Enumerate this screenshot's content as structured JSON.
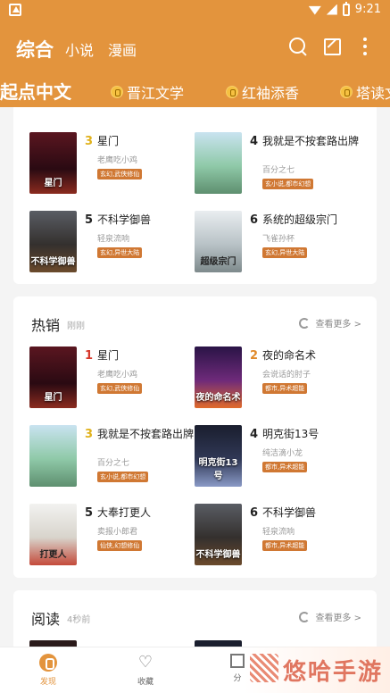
{
  "status": {
    "time": "9:21"
  },
  "appbar": {
    "tabs": [
      "综合",
      "小说",
      "漫画"
    ]
  },
  "channels": [
    {
      "label": "起点中文"
    },
    {
      "label": "晋江文学"
    },
    {
      "label": "红袖添香"
    },
    {
      "label": "塔读文"
    }
  ],
  "section1": {
    "books": [
      {
        "rank": "3",
        "title": "星门",
        "author": "老鹰吃小鸡",
        "tag": "玄幻,武侠修仙",
        "cover_text": "星门",
        "rank_color": "#e0b11b"
      },
      {
        "rank": "4",
        "title": "我就是不按套路出牌",
        "author": "百分之七",
        "tag": "玄小说,都市幻想",
        "cover_text": "",
        "rank_color": "#222"
      },
      {
        "rank": "5",
        "title": "不科学御兽",
        "author": "轻泉流响",
        "tag": "玄幻,异世大陆",
        "cover_text": "不科学御兽",
        "rank_color": "#222"
      },
      {
        "rank": "6",
        "title": "系统的超级宗门",
        "author": "飞雀孙杯",
        "tag": "玄幻,异世大陆",
        "cover_text": "超级宗门",
        "rank_color": "#222"
      }
    ]
  },
  "section2": {
    "title": "热销",
    "subtitle": "刚刚",
    "see_more": "查看更多 >",
    "books": [
      {
        "rank": "1",
        "title": "星门",
        "author": "老鹰吃小鸡",
        "tag": "玄幻,武侠修仙",
        "cover_text": "星门",
        "rank_color": "#d6372b"
      },
      {
        "rank": "2",
        "title": "夜的命名术",
        "author": "会说话的肘子",
        "tag": "都市,异术超能",
        "cover_text": "夜的命名术",
        "rank_color": "#e08a2b"
      },
      {
        "rank": "3",
        "title": "我就是不按套路出牌",
        "author": "百分之七",
        "tag": "玄小说,都市幻想",
        "cover_text": "",
        "rank_color": "#e0b11b"
      },
      {
        "rank": "4",
        "title": "明克街13号",
        "author": "纯洁滴小龙",
        "tag": "都市,异术超能",
        "cover_text": "明克街13号",
        "rank_color": "#222"
      },
      {
        "rank": "5",
        "title": "大奉打更人",
        "author": "卖报小郎君",
        "tag": "仙侠,幻想修仙",
        "cover_text": "打更人",
        "rank_color": "#222"
      },
      {
        "rank": "6",
        "title": "不科学御兽",
        "author": "轻泉流响",
        "tag": "都市,异术超能",
        "cover_text": "不科学御兽",
        "rank_color": "#222"
      }
    ]
  },
  "section3": {
    "title": "阅读",
    "subtitle": "4秒前",
    "see_more": "查看更多 >"
  },
  "bottom_nav": {
    "home": "发现",
    "fav": "收藏",
    "cat": "分"
  },
  "watermark": {
    "text": "悠哈手游"
  }
}
